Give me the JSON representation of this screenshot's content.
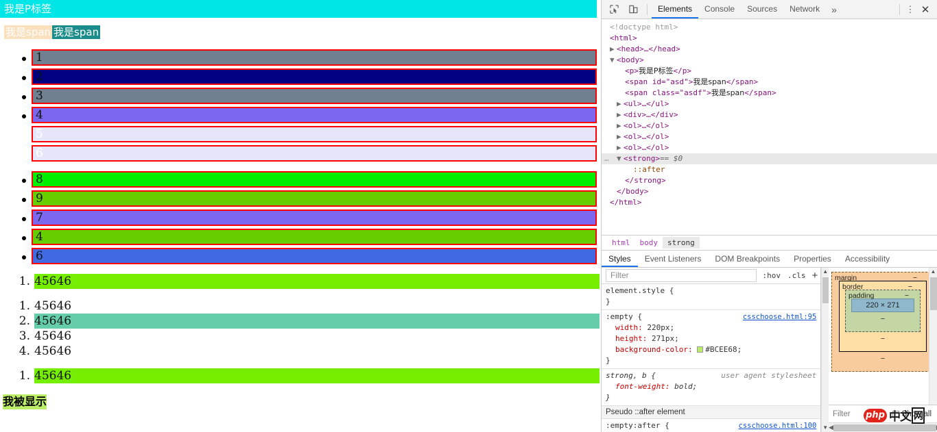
{
  "page": {
    "p_tag_text": "我是P标签",
    "span_a": "我是span",
    "span_b": "我是span",
    "list_one": [
      {
        "text": "1",
        "color": "#708090",
        "bullet": true
      },
      {
        "text": "2",
        "color": "#000080",
        "bullet": true
      },
      {
        "text": "3",
        "color": "#708090",
        "bullet": true
      },
      {
        "text": "4",
        "color": "#7B68EE",
        "bullet": true
      },
      {
        "text": "5",
        "color": "#E6E6FA",
        "bullet": false
      },
      {
        "text": "6",
        "color": "#E6E6FA",
        "bullet": false
      }
    ],
    "list_two": [
      {
        "text": "8",
        "color": "#00EE00",
        "bullet": true
      },
      {
        "text": "9",
        "color": "#66CD00",
        "bullet": true
      },
      {
        "text": "7",
        "color": "#7B68EE",
        "bullet": true
      },
      {
        "text": "4",
        "color": "#66CD00",
        "bullet": true
      },
      {
        "text": "6",
        "color": "#4169E1",
        "bullet": true
      }
    ],
    "ol_one": [
      {
        "marker": "1.",
        "text": "45646",
        "highlight": "green"
      }
    ],
    "ol_two": [
      {
        "marker": "1.",
        "text": "45646",
        "highlight": "none"
      },
      {
        "marker": "2.",
        "text": "45646",
        "highlight": "teal"
      },
      {
        "marker": "3.",
        "text": "45646",
        "highlight": "none"
      },
      {
        "marker": "4.",
        "text": "45646",
        "highlight": "none"
      }
    ],
    "ol_three": [
      {
        "marker": "1.",
        "text": "45646",
        "highlight": "green"
      }
    ],
    "strong_text": "我被显示",
    "colors": {
      "p_bg": "#00E5E5",
      "span_a_bg": "#FBE0BE",
      "span_b_bg": "#1A8C8C",
      "item_border": "#FF0000",
      "ol_green": "#76EE00",
      "ol_teal": "#66CDAA",
      "strong_bg": "#BCEE68"
    }
  },
  "devtools": {
    "toolbar": {
      "inspect_icon": "inspect-cursor-icon",
      "device_icon": "device-toolbar-icon",
      "tabs": [
        {
          "label": "Elements",
          "active": true
        },
        {
          "label": "Console",
          "active": false
        },
        {
          "label": "Sources",
          "active": false
        },
        {
          "label": "Network",
          "active": false
        }
      ],
      "more_tabs": "»",
      "kebab": "⋮",
      "close": "✕"
    },
    "dom_lines": [
      {
        "indent": 1,
        "html": "doctype"
      },
      {
        "indent": 1,
        "html": "html-open"
      },
      {
        "indent": 1,
        "html": "head-collapsed"
      },
      {
        "indent": 1,
        "html": "body-open"
      },
      {
        "indent": 2,
        "html": "p-line"
      },
      {
        "indent": 2,
        "html": "span-id-line"
      },
      {
        "indent": 2,
        "html": "span-class-line"
      },
      {
        "indent": 2,
        "html": "ul-collapsed"
      },
      {
        "indent": 2,
        "html": "div-collapsed"
      },
      {
        "indent": 2,
        "html": "ol-collapsed-1"
      },
      {
        "indent": 2,
        "html": "ol-collapsed-2"
      },
      {
        "indent": 2,
        "html": "ol-collapsed-3"
      },
      {
        "indent": 2,
        "html": "strong-selected"
      },
      {
        "indent": 3,
        "html": "after-pseudo"
      },
      {
        "indent": 2,
        "html": "strong-close"
      },
      {
        "indent": 1,
        "html": "body-close"
      },
      {
        "indent": 1,
        "html": "html-close"
      }
    ],
    "dom_text": {
      "doctype": "<!doctype html>",
      "html_open": "<html>",
      "head": "<head>…</head>",
      "body_open": "<body>",
      "p_open": "<p>",
      "p_text": "我是P标签",
      "p_close": "</p>",
      "span1_open": "<span id=\"asd\">",
      "span1_text": "我是span",
      "span1_close": "</span>",
      "span2_open": "<span class=\"asdf\">",
      "span2_text": "我是span",
      "span2_close": "</span>",
      "ul": "<ul>…</ul>",
      "div": "<div>…</div>",
      "ol1": "<ol>…</ol>",
      "ol2": "<ol>…</ol>",
      "ol3": "<ol>…</ol>",
      "strong_open": "<strong>",
      "strong_marker": "== $0",
      "after": "::after",
      "strong_close": "</strong>",
      "body_close": "</body>",
      "html_close": "</html>",
      "ellipsis_gutter": "…"
    },
    "breadcrumb": [
      {
        "label": "html",
        "active": false
      },
      {
        "label": "body",
        "active": false
      },
      {
        "label": "strong",
        "active": true
      }
    ],
    "panel_tabs": [
      {
        "label": "Styles",
        "active": true
      },
      {
        "label": "Event Listeners",
        "active": false
      },
      {
        "label": "DOM Breakpoints",
        "active": false
      },
      {
        "label": "Properties",
        "active": false
      },
      {
        "label": "Accessibility",
        "active": false
      }
    ],
    "filter": {
      "placeholder": "Filter",
      "hov": ":hov",
      "cls": ".cls",
      "plus": "+"
    },
    "css_rules": [
      {
        "selector": "element.style {",
        "source": "",
        "source_type": "",
        "declarations": [],
        "close": "}"
      },
      {
        "selector": ":empty {",
        "source": "csschoose.html:95",
        "source_type": "link",
        "declarations": [
          {
            "prop": "width:",
            "value": "220px;",
            "swatch": ""
          },
          {
            "prop": "height:",
            "value": "271px;",
            "swatch": ""
          },
          {
            "prop": "background-color:",
            "value": "#BCEE68;",
            "swatch": "#BCEE68"
          }
        ],
        "close": "}"
      },
      {
        "selector": "strong, b {",
        "source": "user agent stylesheet",
        "source_type": "ua",
        "declarations": [
          {
            "prop": "font-weight:",
            "value": "bold;",
            "swatch": ""
          }
        ],
        "close": "}"
      }
    ],
    "pseudo_header": "Pseudo ::after element",
    "pseudo_rule": {
      "selector": ":empty:after {",
      "source": "csschoose.html:100"
    },
    "box_model": {
      "margin_label": "margin",
      "margin_value": "−",
      "border_label": "border",
      "border_value": "−",
      "padding_label": "padding",
      "padding_value": "−",
      "content": "220 × 271",
      "dash": "−"
    },
    "computed": {
      "filter_placeholder": "Filter",
      "show_all": "Show all"
    }
  },
  "watermark": {
    "php": "php",
    "text": "中文",
    "box": "网"
  }
}
